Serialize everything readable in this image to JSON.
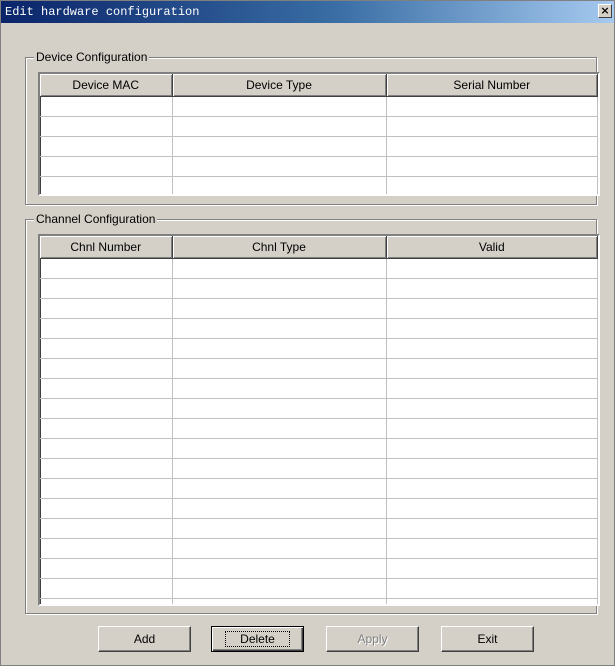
{
  "window": {
    "title": "Edit hardware configuration",
    "close_glyph": "×"
  },
  "device_config": {
    "label": "Device Configuration",
    "columns": [
      "Device MAC",
      "Device Type",
      "Serial Number"
    ],
    "row_count": 5
  },
  "channel_config": {
    "label": "Channel Configuration",
    "columns": [
      "Chnl Number",
      "Chnl Type",
      "Valid"
    ],
    "row_count": 19
  },
  "buttons": {
    "add": "Add",
    "delete": "Delete",
    "apply": "Apply",
    "exit": "Exit"
  }
}
